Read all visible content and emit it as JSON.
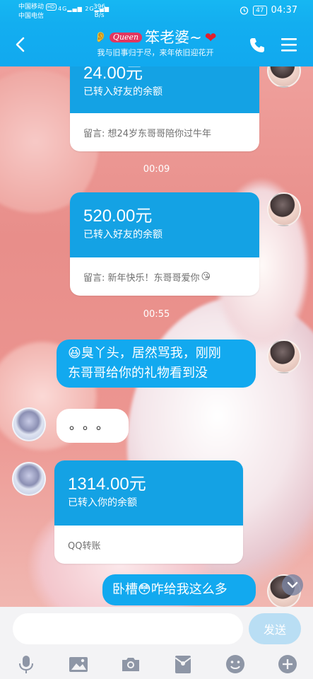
{
  "status_bar": {
    "carrier_1": "中国移动",
    "carrier_1_badge": "HD",
    "carrier_2": "中国电信",
    "signal_1": "4G",
    "signal_2": "2G",
    "net_rate_value": "396",
    "net_rate_unit": "B/s",
    "battery": "47",
    "time": "04:37"
  },
  "header": {
    "badge_text": "Queen",
    "title": "笨老婆~",
    "subtitle": "我与旧事归于尽，来年依旧迎花开"
  },
  "messages": [
    {
      "type": "transfer",
      "side": "right",
      "amount": "24.00元",
      "desc": "已转入好友的余额",
      "note": "留言: 想24岁东哥哥陪你过牛年"
    },
    {
      "type": "time",
      "text": "00:09"
    },
    {
      "type": "transfer",
      "side": "right",
      "amount": "520.00元",
      "desc": "已转入好友的余额",
      "note": "留言: 新年快乐！东哥哥爱你"
    },
    {
      "type": "time",
      "text": "00:55"
    },
    {
      "type": "text",
      "side": "right",
      "line1": "臭丫头，居然骂我，刚刚",
      "line2": "东哥哥给你的礼物看到没"
    },
    {
      "type": "text",
      "side": "left",
      "text": "。。。"
    },
    {
      "type": "transfer",
      "side": "left",
      "amount": "1314.00元",
      "desc": "已转入你的余额",
      "note": "QQ转账"
    },
    {
      "type": "text",
      "side": "right",
      "part1": "卧槽",
      "part2": "咋给我这么多"
    }
  ],
  "input": {
    "placeholder": "",
    "send_label": "发送"
  },
  "toolbar_icons": [
    "mic-icon",
    "image-icon",
    "camera-icon",
    "red-packet-icon",
    "emoji-icon",
    "plus-icon"
  ],
  "colors": {
    "header_blue": "#13aef0",
    "bubble_blue": "#12a9ef",
    "card_blue": "#14a2e4",
    "send_disabled": "#b9def4"
  }
}
